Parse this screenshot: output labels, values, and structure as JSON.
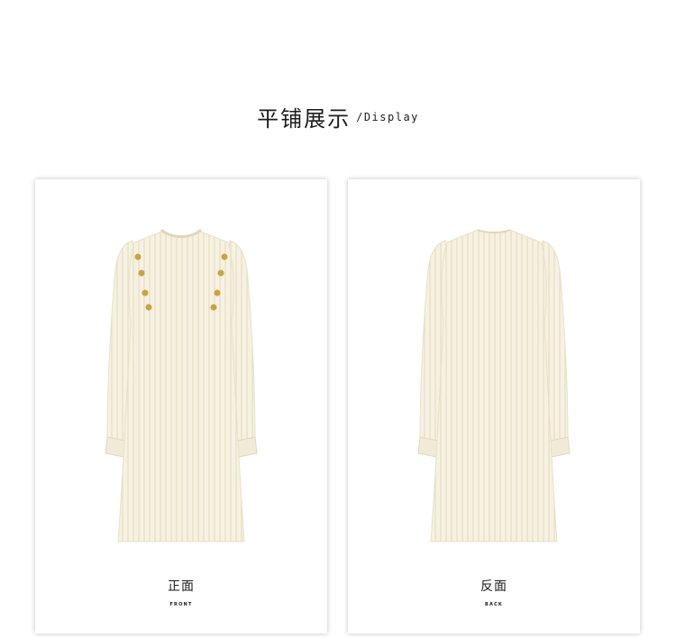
{
  "heading": {
    "title_zh": "平铺展示",
    "title_en": "/Display"
  },
  "views": [
    {
      "label_zh": "正面",
      "label_en": "FRONT"
    },
    {
      "label_zh": "反面",
      "label_en": "BACK"
    }
  ],
  "colors": {
    "background": "#ffffff",
    "dress": "#f6f1e1",
    "rib": "#e5dcc4",
    "button": "#c9a341",
    "text": "#1c1c1c"
  }
}
